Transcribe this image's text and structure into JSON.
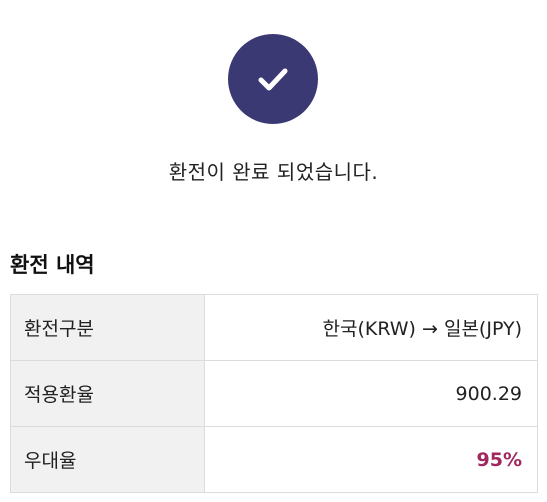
{
  "icon": {
    "name": "check-icon",
    "circle_color": "#3b3974"
  },
  "message": "환전이 완료 되었습니다.",
  "section_title": "환전 내역",
  "rows": [
    {
      "label": "환전구분",
      "value": "한국(KRW) → 일본(JPY)"
    },
    {
      "label": "적용환율",
      "value": "900.29"
    },
    {
      "label": "우대율",
      "value": "95%"
    }
  ],
  "colors": {
    "highlight": "#a0285e"
  }
}
